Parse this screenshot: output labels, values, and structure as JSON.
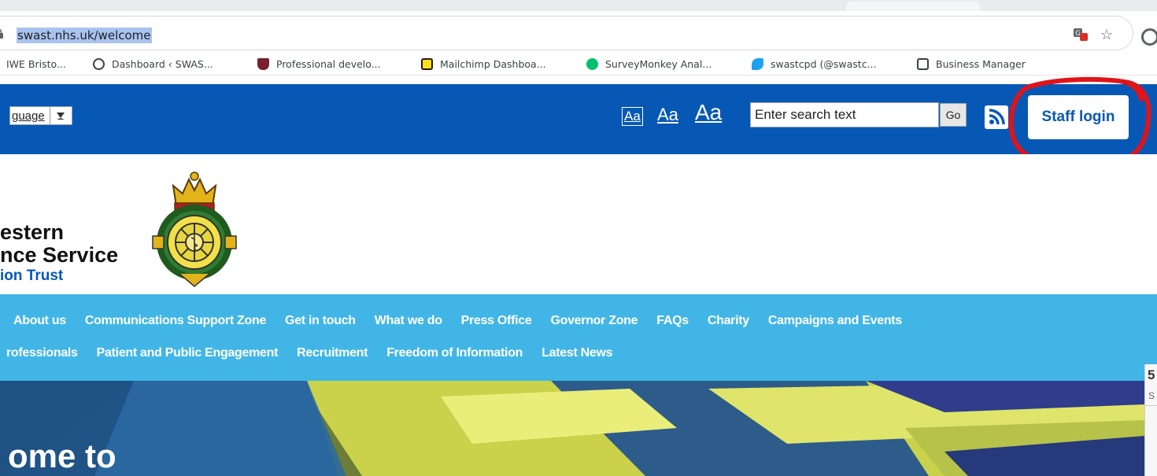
{
  "browser": {
    "url": "swast.nhs.uk/welcome",
    "bookmarks": [
      {
        "label": "IWE Bristo...",
        "icon": "uwe-icon",
        "color": "#c4c4c4"
      },
      {
        "label": "Dashboard ‹ SWAS...",
        "icon": "wordpress-icon",
        "color": "#3c4043"
      },
      {
        "label": "Professional develo...",
        "icon": "shield-crest-icon",
        "color": "#7a1f2b"
      },
      {
        "label": "Mailchimp Dashboa...",
        "icon": "mailchimp-icon",
        "color": "#ffe01b"
      },
      {
        "label": "SurveyMonkey Anal...",
        "icon": "surveymonkey-icon",
        "color": "#00bf6f"
      },
      {
        "label": "swastcpd (@swastc...",
        "icon": "twitter-icon",
        "color": "#1da1f2"
      },
      {
        "label": "Business Manager",
        "icon": "business-manager-icon",
        "color": "#3c4043"
      }
    ]
  },
  "header": {
    "language_label": "guage",
    "text_size_small": "Aa",
    "text_size_medium": "Aa",
    "text_size_large": "Aa",
    "search_placeholder": "Enter search text",
    "go_label": "Go",
    "staff_login_label": "Staff login",
    "annotation_color": "#e0131b"
  },
  "logo": {
    "line1": "estern",
    "line2": "nce Service",
    "line3": "ion Trust"
  },
  "nav": {
    "row1": [
      "About us",
      "Communications Support Zone",
      "Get in touch",
      "What we do",
      "Press Office",
      "Governor Zone",
      "FAQs",
      "Charity",
      "Campaigns and Events"
    ],
    "row2": [
      "rofessionals",
      "Patient and Public Engagement",
      "Recruitment",
      "Freedom of Information",
      "Latest News"
    ]
  },
  "hero": {
    "heading": "ome to",
    "side_number": "5",
    "side_letter": "S"
  },
  "colors": {
    "topbar": "#0758b5",
    "nav": "#41b6e6",
    "brand_blue": "#0758b5"
  }
}
